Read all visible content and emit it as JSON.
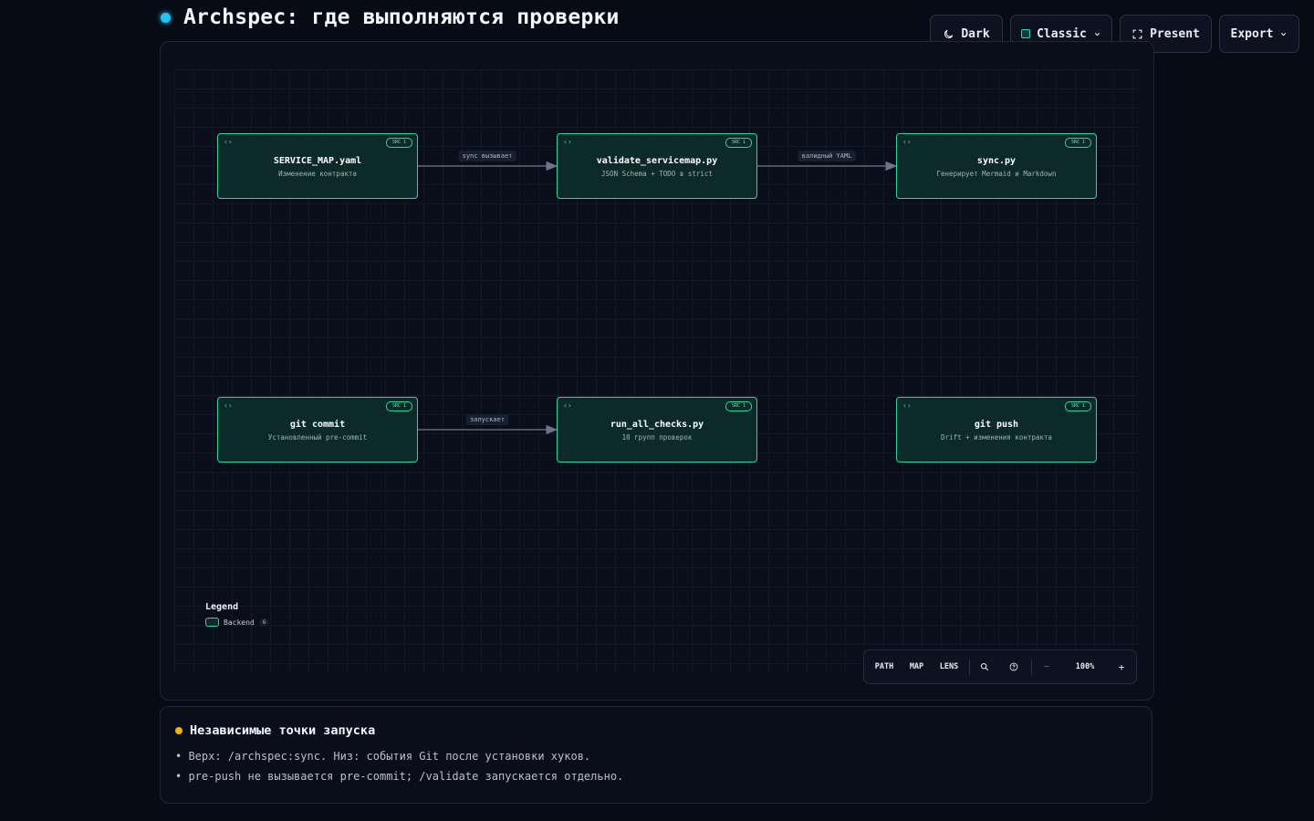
{
  "header": {
    "title": "Archspec: где выполняются проверки"
  },
  "toolbar": {
    "theme_label": "Dark",
    "style_label": "Classic",
    "present_label": "Present",
    "export_label": "Export"
  },
  "diagram": {
    "nodes": [
      {
        "title": "SERVICE_MAP.yaml",
        "subtitle": "Изменение контракта",
        "badge": "SRC 1"
      },
      {
        "title": "validate_servicemap.py",
        "subtitle": "JSON Schema + TODO в strict",
        "badge": "SRC 1"
      },
      {
        "title": "sync.py",
        "subtitle": "Генерирует Mermaid и Markdown",
        "badge": "SRC 1"
      },
      {
        "title": "git commit",
        "subtitle": "Установленный pre-commit",
        "badge": "SRC 1"
      },
      {
        "title": "run_all_checks.py",
        "subtitle": "10 групп проверок",
        "badge": "SRC 1"
      },
      {
        "title": "git push",
        "subtitle": "Drift + изменения контракта",
        "badge": "SRC 1"
      }
    ],
    "edges": [
      {
        "from": "SERVICE_MAP.yaml",
        "to": "validate_servicemap.py",
        "label": "sync вызывает"
      },
      {
        "from": "validate_servicemap.py",
        "to": "sync.py",
        "label": "валидный YAML"
      },
      {
        "from": "git commit",
        "to": "run_all_checks.py",
        "label": "запускает"
      }
    ]
  },
  "legend": {
    "title": "Legend",
    "items": [
      {
        "label": "Backend",
        "count": "6",
        "color": "#34d39c"
      }
    ]
  },
  "controls": {
    "path_label": "PATH",
    "map_label": "MAP",
    "lens_label": "LENS",
    "zoom_out": "—",
    "zoom": "100%",
    "zoom_in": "+"
  },
  "notes": {
    "title": "Независимые точки запуска",
    "lines": [
      "• Верх: /archspec:sync. Низ: события Git после установки хуков.",
      "• pre-push не вызывается pre-commit; /validate запускается отдельно."
    ]
  },
  "colors": {
    "accent": "#22c3ee",
    "node_border": "#34d39c",
    "note_dot": "#f5b400"
  }
}
